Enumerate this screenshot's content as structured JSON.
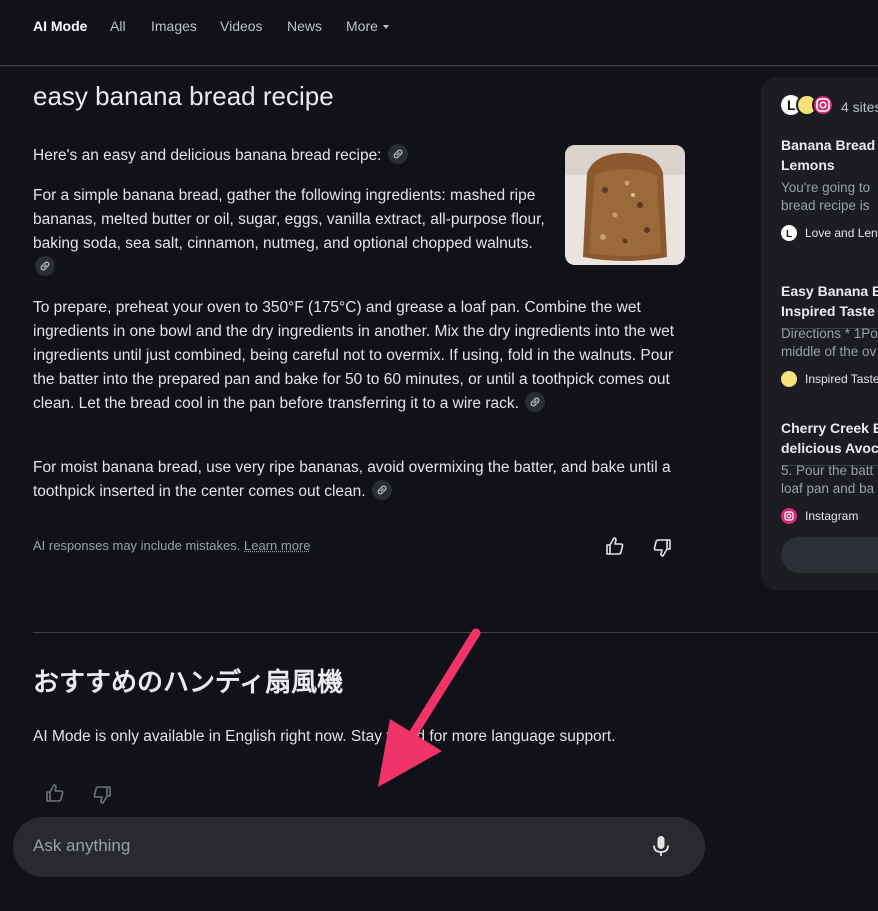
{
  "tabs": [
    {
      "label": "AI Mode"
    },
    {
      "label": "All"
    },
    {
      "label": "Images"
    },
    {
      "label": "Videos"
    },
    {
      "label": "News"
    },
    {
      "label": "More"
    }
  ],
  "answer": {
    "query": "easy banana bread recipe",
    "paragraphs": [
      "Here's an easy and delicious banana bread recipe:",
      "For a simple banana bread, gather the following ingredients: mashed ripe bananas, melted butter or oil, sugar, eggs, vanilla extract, all-purpose flour, baking soda, sea salt, cinnamon, nutmeg, and optional chopped walnuts.",
      "To prepare, preheat your oven to 350°F (175°C) and grease a loaf pan. Combine the wet ingredients in one bowl and the dry ingredients in another. Mix the dry ingredients into the wet ingredients until just combined, being careful not to overmix. If using, fold in the walnuts. Pour the batter into the prepared pan and bake for 50 to 60 minutes, or until a toothpick comes out clean. Let the bread cool in the pan before transferring it to a wire rack.",
      "For moist banana bread, use very ripe bananas, avoid overmixing the batter, and bake until a toothpick inserted in the center comes out clean."
    ],
    "disclaimer": "AI responses may include mistakes.",
    "learn_more": "Learn more"
  },
  "sources": {
    "count_label": "4 sites",
    "items": [
      {
        "title_1": "Banana Bread",
        "title_2": "Lemons",
        "desc_1": "You're going to",
        "desc_2": "bread recipe is",
        "site": "Love and Len"
      },
      {
        "title_1": "Easy Banana B",
        "title_2": "Inspired Taste",
        "desc_1": "Directions * 1Po",
        "desc_2": "middle of the ov",
        "site": "Inspired Taste"
      },
      {
        "title_1": "Cherry Creek B",
        "title_2": "delicious Avoca",
        "desc_1": "5. Pour the batt",
        "desc_2": "loaf pan and ba",
        "site": "Instagram"
      }
    ]
  },
  "followup": {
    "query": "おすすめのハンディ扇風機",
    "note": "AI Mode is only available in English right now. Stay tuned for more language support."
  },
  "ask": {
    "placeholder": "Ask anything"
  },
  "colors": {
    "background": "#101218",
    "arrow": "#f0346a",
    "panel": "#1b1d22"
  }
}
